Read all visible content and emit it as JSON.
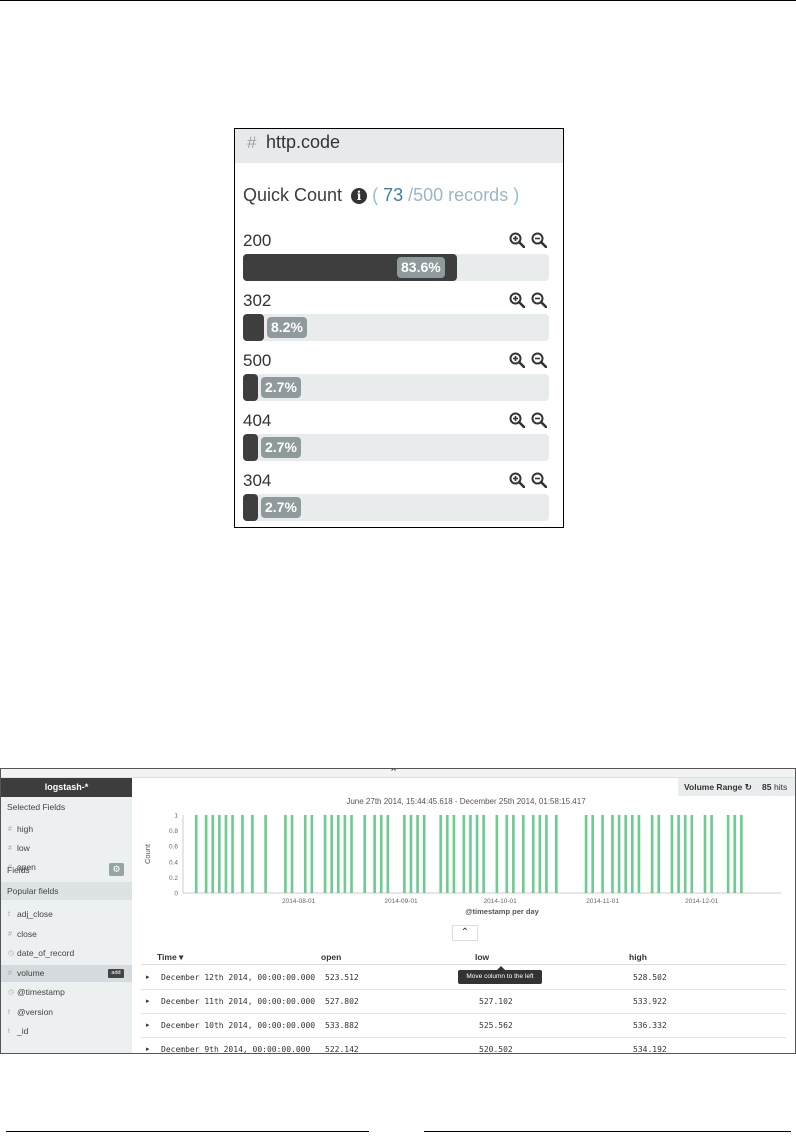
{
  "quick_count": {
    "hash_icon": "#",
    "field_name": "http.code",
    "title": "Quick Count",
    "info_icon": "info-circle",
    "paren_open": "(",
    "count": "73",
    "total": "/500 records",
    "paren_close": ")",
    "colors": {
      "bar": "#3e3e3e",
      "track": "#e9ecec",
      "label": "#8e9a9c"
    },
    "rows": [
      {
        "value": "200",
        "percent_label": "83.6%",
        "fraction": 0.836
      },
      {
        "value": "302",
        "percent_label": "8.2%",
        "fraction": 0.082
      },
      {
        "value": "500",
        "percent_label": "2.7%",
        "fraction": 0.027
      },
      {
        "value": "404",
        "percent_label": "2.7%",
        "fraction": 0.027
      },
      {
        "value": "304",
        "percent_label": "2.7%",
        "fraction": 0.027
      }
    ]
  },
  "discover": {
    "index_pattern": "logstash-*",
    "sidebar": {
      "selected_fields_label": "Selected Fields",
      "selected_fields": [
        {
          "type": "#",
          "name": "high"
        },
        {
          "type": "#",
          "name": "low"
        },
        {
          "type": "#",
          "name": "open"
        }
      ],
      "fields_label": "Fields",
      "popular_label": "Popular fields",
      "popular_fields": [
        {
          "type": "t",
          "name": "adj_close"
        },
        {
          "type": "#",
          "name": "close"
        },
        {
          "type": "◷",
          "name": "date_of_record"
        },
        {
          "type": "#",
          "name": "volume",
          "highlighted": true,
          "add_label": "add"
        },
        {
          "type": "◷",
          "name": "@timestamp"
        },
        {
          "type": "t",
          "name": "@version"
        },
        {
          "type": "t",
          "name": "_id"
        }
      ]
    },
    "hits_label": "Volume Range ↻",
    "hits_count": "85",
    "hits_unit": "hits",
    "time_range": "June 27th 2014, 15:44:45.618 - December 25th 2014, 01:58:15.417",
    "table": {
      "columns": [
        "Time ▾",
        "open",
        "low",
        "high"
      ],
      "tooltip": "Move column to the left",
      "rows": [
        {
          "time": "December 12th 2014, 00:00:00.000",
          "open": "523.512",
          "low": "",
          "high": "528.502"
        },
        {
          "time": "December 11th 2014, 00:00:00.000",
          "open": "527.802",
          "low": "527.102",
          "high": "533.922"
        },
        {
          "time": "December 10th 2014, 00:00:00.000",
          "open": "533.882",
          "low": "525.562",
          "high": "536.332"
        },
        {
          "time": "December 9th 2014, 00:00:00.000",
          "open": "522.142",
          "low": "520.502",
          "high": "534.192"
        }
      ]
    }
  },
  "chart_data": {
    "type": "bar",
    "color": "#6dcc8f",
    "ylabel": "Count",
    "xlabel": "@timestamp per day",
    "ylim": [
      0,
      1
    ],
    "yticks": [
      "1",
      "0.8",
      "0.6",
      "0.4",
      "0.2",
      "0"
    ],
    "xticks": [
      {
        "label": "2014-08-01",
        "day": 35
      },
      {
        "label": "2014-09-01",
        "day": 66
      },
      {
        "label": "2014-10-01",
        "day": 96
      },
      {
        "label": "2014-11-01",
        "day": 127
      },
      {
        "label": "2014-12-01",
        "day": 157
      }
    ],
    "x_domain": [
      0,
      181
    ],
    "bar_days": [
      4,
      7,
      9,
      11,
      13,
      15,
      18,
      21,
      25,
      31,
      33,
      37,
      39,
      43,
      45,
      47,
      49,
      51,
      55,
      58,
      60,
      62,
      67,
      69,
      71,
      73,
      78,
      80,
      82,
      85,
      87,
      89,
      91,
      95,
      98,
      100,
      103,
      106,
      108,
      110,
      113,
      122,
      124,
      127,
      130,
      132,
      134,
      136,
      138,
      142,
      144,
      148,
      150,
      152,
      154,
      158,
      160,
      165,
      167,
      169
    ],
    "bar_values": [
      1,
      1,
      1,
      1,
      1,
      1,
      1,
      1,
      1,
      1,
      1,
      1,
      1,
      1,
      1,
      1,
      1,
      1,
      1,
      1,
      1,
      1,
      1,
      1,
      1,
      1,
      1,
      1,
      1,
      1,
      1,
      1,
      1,
      1,
      1,
      1,
      1,
      1,
      1,
      1,
      1,
      1,
      1,
      1,
      1,
      1,
      1,
      1,
      1,
      1,
      1,
      1,
      1,
      1,
      1,
      1,
      1,
      1,
      1,
      1
    ]
  }
}
